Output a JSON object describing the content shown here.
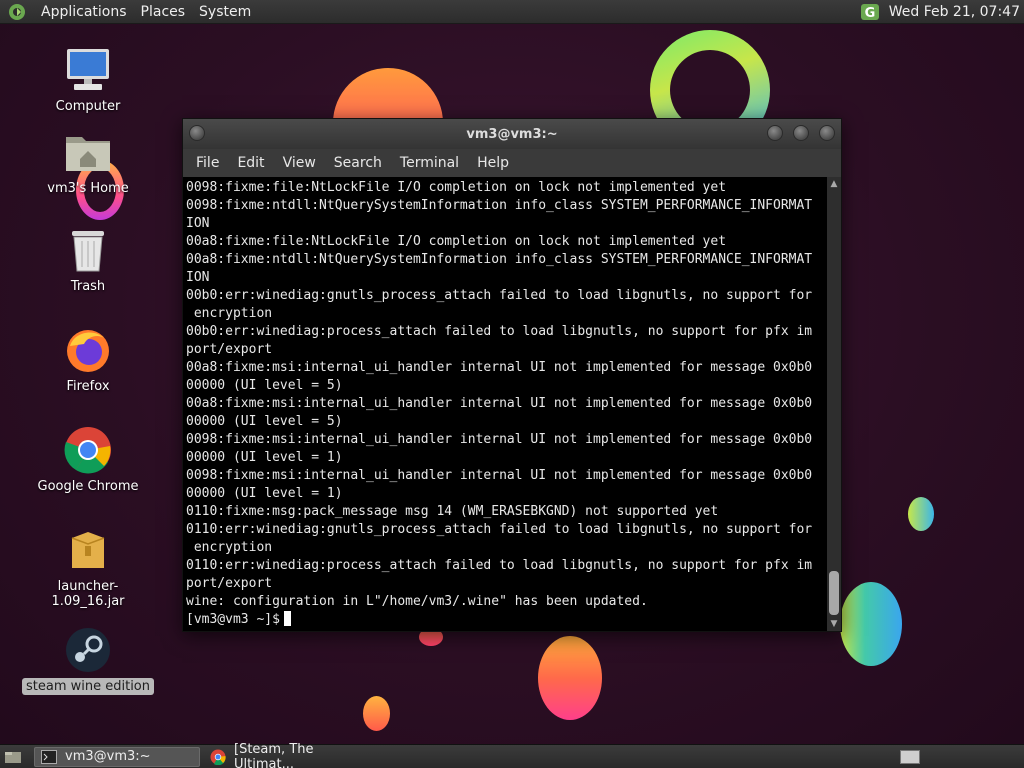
{
  "top_panel": {
    "menus": [
      "Applications",
      "Places",
      "System"
    ],
    "clock": "Wed Feb 21, 07:47"
  },
  "desktop": {
    "icons": [
      {
        "label": "Computer",
        "icon": "computer-icon"
      },
      {
        "label": "vm3's Home",
        "icon": "home-folder-icon"
      },
      {
        "label": "Trash",
        "icon": "trash-icon"
      },
      {
        "label": "Firefox",
        "icon": "firefox-icon"
      },
      {
        "label": "Google Chrome",
        "icon": "chrome-icon"
      },
      {
        "label": "launcher-1.09_16.jar",
        "icon": "jar-file-icon"
      },
      {
        "label": "steam wine edition",
        "icon": "steam-icon"
      }
    ]
  },
  "terminal": {
    "title": "vm3@vm3:~",
    "menu": [
      "File",
      "Edit",
      "View",
      "Search",
      "Terminal",
      "Help"
    ],
    "lines": [
      "0098:fixme:file:NtLockFile I/O completion on lock not implemented yet",
      "0098:fixme:ntdll:NtQuerySystemInformation info_class SYSTEM_PERFORMANCE_INFORMAT",
      "ION",
      "00a8:fixme:file:NtLockFile I/O completion on lock not implemented yet",
      "00a8:fixme:ntdll:NtQuerySystemInformation info_class SYSTEM_PERFORMANCE_INFORMAT",
      "ION",
      "00b0:err:winediag:gnutls_process_attach failed to load libgnutls, no support for",
      " encryption",
      "00b0:err:winediag:process_attach failed to load libgnutls, no support for pfx im",
      "port/export",
      "00a8:fixme:msi:internal_ui_handler internal UI not implemented for message 0x0b0",
      "00000 (UI level = 5)",
      "00a8:fixme:msi:internal_ui_handler internal UI not implemented for message 0x0b0",
      "00000 (UI level = 5)",
      "0098:fixme:msi:internal_ui_handler internal UI not implemented for message 0x0b0",
      "00000 (UI level = 1)",
      "0098:fixme:msi:internal_ui_handler internal UI not implemented for message 0x0b0",
      "00000 (UI level = 1)",
      "0110:fixme:msg:pack_message msg 14 (WM_ERASEBKGND) not supported yet",
      "0110:err:winediag:gnutls_process_attach failed to load libgnutls, no support for",
      " encryption",
      "0110:err:winediag:process_attach failed to load libgnutls, no support for pfx im",
      "port/export",
      "wine: configuration in L\"/home/vm3/.wine\" has been updated."
    ],
    "prompt": "[vm3@vm3 ~]$"
  },
  "taskbar": {
    "tasks": [
      {
        "label": "vm3@vm3:~",
        "icon": "terminal-icon",
        "active": true
      },
      {
        "label": "[Steam, The Ultimat...",
        "icon": "chrome-icon",
        "active": false
      }
    ]
  }
}
